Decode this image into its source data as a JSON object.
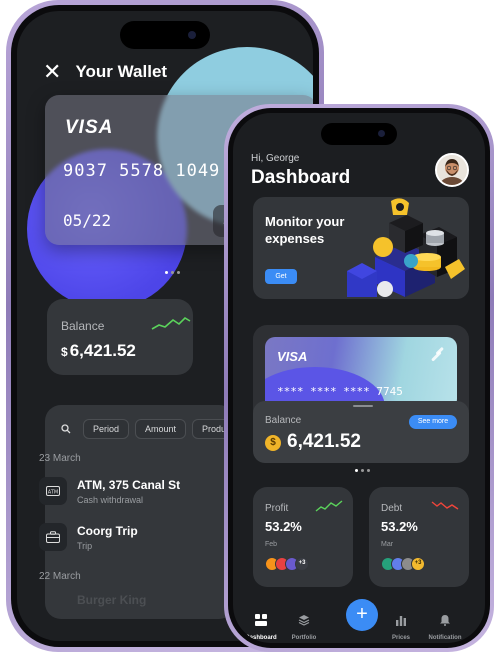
{
  "wallet": {
    "title": "Your Wallet",
    "card": {
      "brand": "VISA",
      "number": "9037 5578 1049 774",
      "expiry": "05/22",
      "button_label": "Sh"
    },
    "balance": {
      "label": "Balance",
      "currency": "$",
      "value": "6,421.52"
    },
    "filters": [
      "Period",
      "Amount",
      "Product"
    ],
    "groups": [
      {
        "date": "23 March",
        "items": [
          {
            "title": "ATM, 375 Canal St",
            "subtitle": "Cash withdrawal",
            "icon": "atm-icon"
          },
          {
            "title": "Coorg Trip",
            "subtitle": "Trip",
            "icon": "briefcase-icon"
          }
        ]
      },
      {
        "date": "22 March",
        "items": [
          {
            "title": "Burger King",
            "subtitle": ""
          }
        ]
      }
    ]
  },
  "dashboard": {
    "greeting": "Hi, George",
    "title": "Dashboard",
    "banner": {
      "text": "Monitor your expenses",
      "button": "Get"
    },
    "card": {
      "brand": "VISA",
      "number": "**** **** **** 7745"
    },
    "balance": {
      "label": "Balance",
      "currency": "$",
      "value": "6,421.52",
      "see_more": "See more"
    },
    "stats": [
      {
        "label": "Profit",
        "value": "53.2%",
        "month": "Feb",
        "trend_color": "#5bd35b",
        "chip_more": "+3"
      },
      {
        "label": "Debt",
        "value": "53.2%",
        "month": "Mar",
        "trend_color": "#f0453a",
        "chip_more": "+3"
      }
    ],
    "nav": [
      "Dashboard",
      "Portfolio",
      "Prices",
      "Notification"
    ],
    "fab": "+"
  },
  "colors": {
    "accent": "#3b8cf5",
    "up": "#5bd35b",
    "down": "#f0453a"
  }
}
